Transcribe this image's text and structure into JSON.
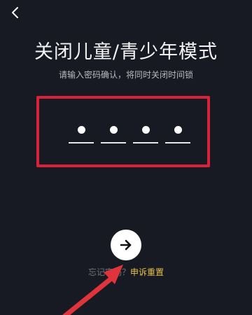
{
  "header": {
    "back_icon": "chevron-left-icon"
  },
  "main": {
    "title": "关闭儿童/青少年模式",
    "subtitle": "请输入密码确认，将同时关闭时间锁",
    "pin_length": 4,
    "pin_filled": 4
  },
  "actions": {
    "submit_icon": "arrow-right-icon",
    "forgot_label": "忘记密码？",
    "reset_label": "申诉重置"
  },
  "colors": {
    "background": "#171a22",
    "highlight_border": "#d7223a",
    "annotation_arrow": "#e0343d",
    "link": "#e9c24a"
  }
}
